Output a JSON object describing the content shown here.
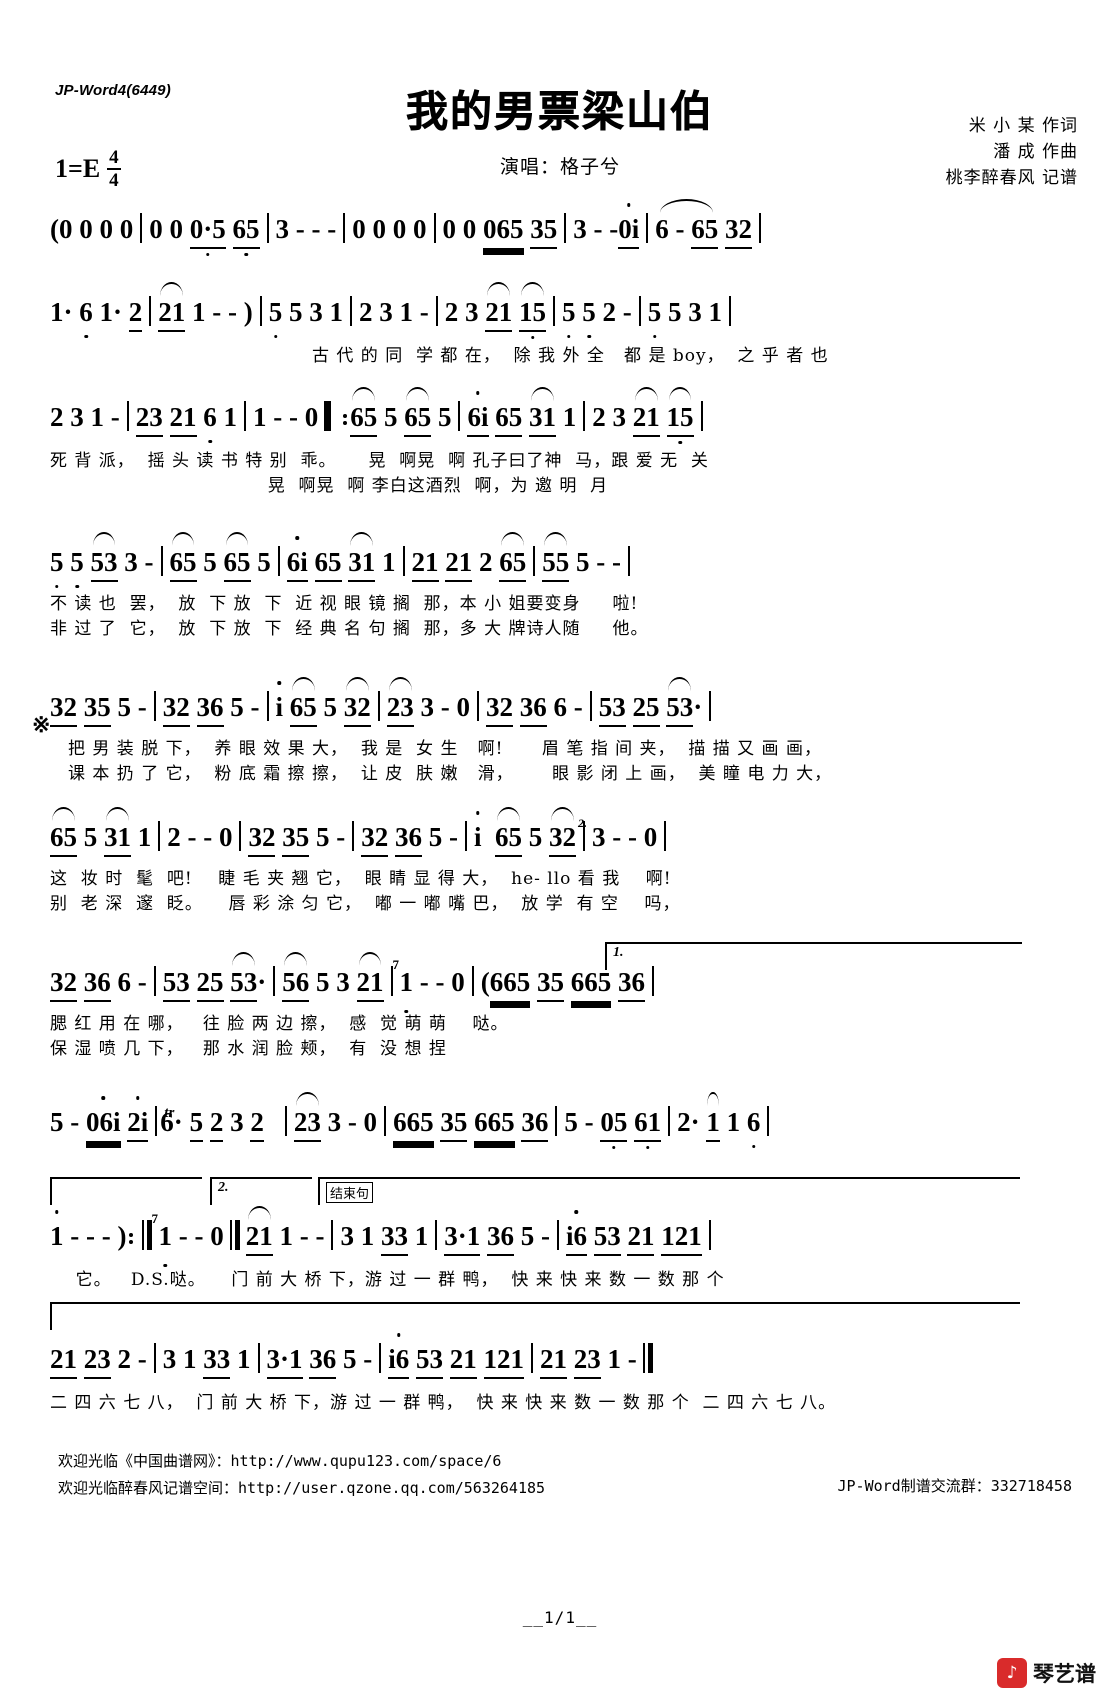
{
  "header": {
    "jp_word_tag": "JP-Word4(6449)",
    "title": "我的男票梁山伯",
    "singer_line": "演唱：格子兮",
    "key_signature": "1=E",
    "time_num": "4",
    "time_den": "4",
    "credits": [
      "米 小 某 作词",
      "潘    成 作曲",
      "桃李醉春风 记谱"
    ]
  },
  "systems": [
    {
      "id": "system-1",
      "measures": [
        "( 0 0 0 0",
        "0 0 0·5 65",
        "3 - - -",
        "0 0 0 0",
        "0 0 065 35",
        "3 - - 0i",
        "6 - 65 32"
      ],
      "lyrics": []
    },
    {
      "id": "system-2",
      "measures": [
        "1· 6 1· 2",
        "21 1 - - )",
        "5 5 3 1",
        "2 3 1 -",
        "2 3 21 15",
        "5 5 2 -",
        "5 5 3 1"
      ],
      "lyrics": [
        "古 代 的 同  学 都 在，  除 我 外 全   都 是 boy，  之 乎 者 也"
      ]
    },
    {
      "id": "system-3",
      "measures": [
        "2 3 1 -",
        "23 21 6 1",
        "1 - - 0",
        "65 5 65 5",
        "6i 65 31 1",
        "2 3 21 15"
      ],
      "lyrics": [
        "死 背 派，  摇 头 读 书 特 别  乖。     晃  啊晃  啊 孔子曰了神  马，跟 爱 无  关",
        "                                  晃  啊晃  啊 李白这酒烈  啊，为 邀 明  月"
      ]
    },
    {
      "id": "system-4",
      "measures": [
        "5 5 53 3 -",
        "65 5 65 5",
        "6i 65 31 1",
        "21 21 2 65",
        "55 5 - -"
      ],
      "lyrics": [
        "不 读 也  罢，  放  下 放  下  近 视 眼 镜 搁  那，本 小 姐要变身     啦!",
        "非 过 了  它，  放  下 放  下  经 典 名 句 搁  那，多 大 牌诗人随     他。"
      ]
    },
    {
      "id": "system-5",
      "measures": [
        "32 35 5 -",
        "32 36 5 -",
        "i 65 5 32",
        "23 3 - 0",
        "32 36 6 -",
        "53 25 53·"
      ],
      "lyrics": [
        "把 男 装 脱 下，  养 眼 效 果 大，  我 是  女 生   啊!      眉 笔 指 间 夹，  描 描 又 画 画，",
        "课 本 扔 了 它，  粉 底 霜 擦 擦，  让 皮  肤 嫩   滑，      眼 影 闭 上 画，  美 瞳 电 力 大，"
      ]
    },
    {
      "id": "system-6",
      "measures": [
        "65 5 31 1",
        "2 - - 0",
        "32 35 5 -",
        "32 36 5 -",
        "i 65 5 32",
        "3 - - 0"
      ],
      "lyrics": [
        "这  妆 时  髦  吧!    睫 毛 夹 翘 它，  眼 睛 显 得 大，  he- llo 看 我    啊!",
        "别  老 深  邃  眨。    唇 彩 涂 匀 它，  嘟 一 嘟 嘴 巴，  放 学  有 空    吗，"
      ]
    },
    {
      "id": "system-7",
      "measures": [
        "32 36 6 -",
        "53 25 53·",
        "56 5 3 21",
        "1 - - 0",
        "( 665 35 665 36"
      ],
      "lyrics": [
        "腮 红 用 在 哪，   往 脸 两 边 擦，  感  觉 萌 萌    哒。",
        "保 湿 喷 几 下，   那 水 润 脸 颊，  有  没 想 捏"
      ]
    },
    {
      "id": "system-8",
      "measures": [
        "5 - 06i 2i",
        "6·5 23 2",
        "23 3 - 0",
        "665 35 665 36",
        "5 - 05 61",
        "2· 1 1 6"
      ],
      "lyrics": []
    },
    {
      "id": "system-9",
      "measures": [
        "1 - - - )",
        "1 - - 0",
        "21 1 - -",
        "3 1 33 1",
        "3·1 36 5 -",
        "i6 53 21 121"
      ],
      "lyrics": [
        "    它。   D.S.哒。    门 前 大 桥 下，游 过 一 群 鸭，  快 来 快 来 数 一 数 那 个"
      ]
    },
    {
      "id": "system-10",
      "measures": [
        "21 23 2 -",
        "3 1 33 1",
        "3·1 36 5 -",
        "i6 53 21 121",
        "21 23 1 -"
      ],
      "lyrics": [
        "二 四 六 七 八，  门 前 大 桥 下，游 过 一 群 鸭，  快 来 快 来 数 一 数 那 个  二 四 六 七 八。"
      ]
    }
  ],
  "markings": {
    "segno": "※",
    "volta_1": "1.",
    "volta_2": "2.",
    "ending_label": "结束句",
    "trill": "tr",
    "ds_label": "D.S."
  },
  "footer": {
    "line1": "欢迎光临《中国曲谱网》：http://www.qupu123.com/space/6",
    "line2": "欢迎光临醉春风记谱空间：http://user.qzone.qq.com/563264185",
    "right": "JP-Word制谱交流群：332718458",
    "page_number": "__1/1__",
    "logo_text": "琴艺谱",
    "logo_mark": "♪"
  },
  "colors": {
    "ink": "#000000",
    "paper": "#ffffff",
    "logo_red": "#d92b2b"
  }
}
